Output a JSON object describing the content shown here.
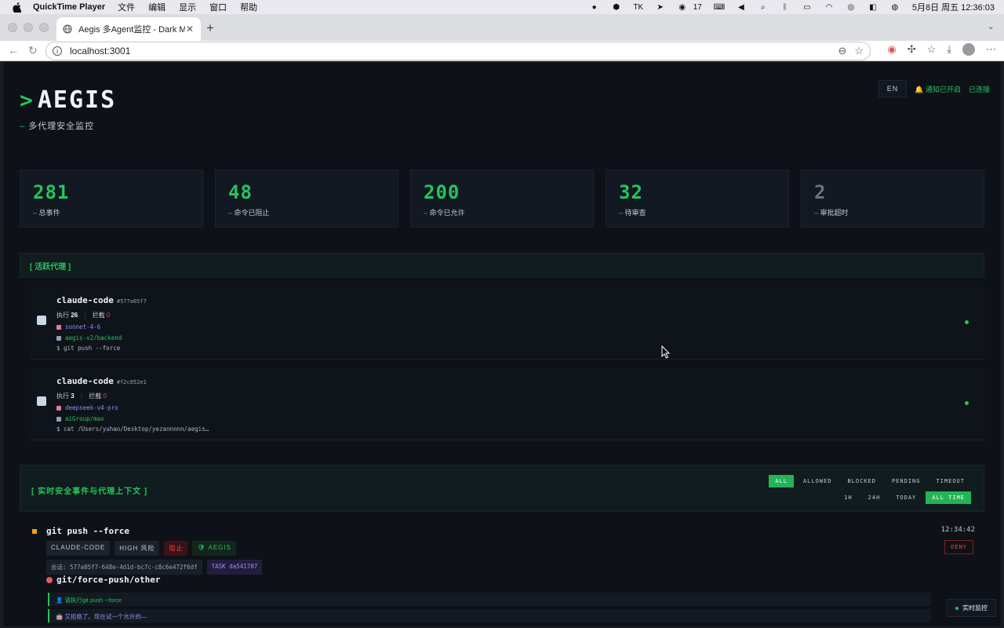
{
  "menubar": {
    "app": "QuickTime Player",
    "items": [
      "文件",
      "编辑",
      "显示",
      "窗口",
      "帮助"
    ],
    "status": {
      "tk": "TK",
      "wechat_count": "17",
      "clock": "5月8日 周五 12:36:03"
    }
  },
  "browser": {
    "tab_title": "Aegis 多Agent监控 - Dark Minim",
    "url": "localhost:3001"
  },
  "header": {
    "logo": "AEGIS",
    "subtitle": "多代理安全监控",
    "lang": "EN",
    "notify": "通知已开启",
    "connection": "已连接"
  },
  "stats": [
    {
      "value": "281",
      "label": "总事件"
    },
    {
      "value": "48",
      "label": "命令已阻止"
    },
    {
      "value": "200",
      "label": "命令已允许"
    },
    {
      "value": "32",
      "label": "待审查"
    },
    {
      "value": "2",
      "label": "审批超时"
    }
  ],
  "agents_section": {
    "title": "[ 活跃代理 ]"
  },
  "agents": [
    {
      "name": "claude-code",
      "id": "#577a05f7",
      "exec_label": "执行",
      "exec_count": "26",
      "block_label": "拦截",
      "block_count": "0",
      "model": "sonnet-4-6",
      "project": "aegis-v2/backend",
      "last_cmd": "$ git push --force"
    },
    {
      "name": "claude-code",
      "id": "#f2c052e1",
      "exec_label": "执行",
      "exec_count": "3",
      "block_label": "拦截",
      "block_count": "0",
      "model": "deepseek-v4-pro",
      "project": "aiGroup/max",
      "last_cmd": "$ cat /Users/yuhao/Desktop/yezannnnn/aegis…"
    }
  ],
  "events_section": {
    "title": "[ 实时安全事件与代理上下文 ]",
    "status_filters": [
      "ALL",
      "ALLOWED",
      "BLOCKED",
      "PENDING",
      "TIMEOUT"
    ],
    "time_filters": [
      "1H",
      "24H",
      "TODAY",
      "ALL TIME"
    ],
    "active_status": "ALL",
    "active_time": "ALL TIME"
  },
  "event": {
    "command": "git push --force",
    "time": "12:34:42",
    "decision": "DENY",
    "tags": [
      "CLAUDE-CODE",
      "HIGH 风险",
      "阻止",
      "AEGIS"
    ],
    "session": "会话: 577a05f7-648e-4d1d-bc7c-c8c6e472f6df",
    "task": "TASK da541707",
    "rule": "git/force-push/other",
    "conversation": [
      "请执行git push --force",
      "又拒绝了。现在试一个允许的—"
    ]
  },
  "live_button": "实时监控",
  "colors": {
    "accent": "#24c55d",
    "danger": "#ef4444",
    "purple": "#9b8cf3",
    "bg": "#0e1218"
  }
}
